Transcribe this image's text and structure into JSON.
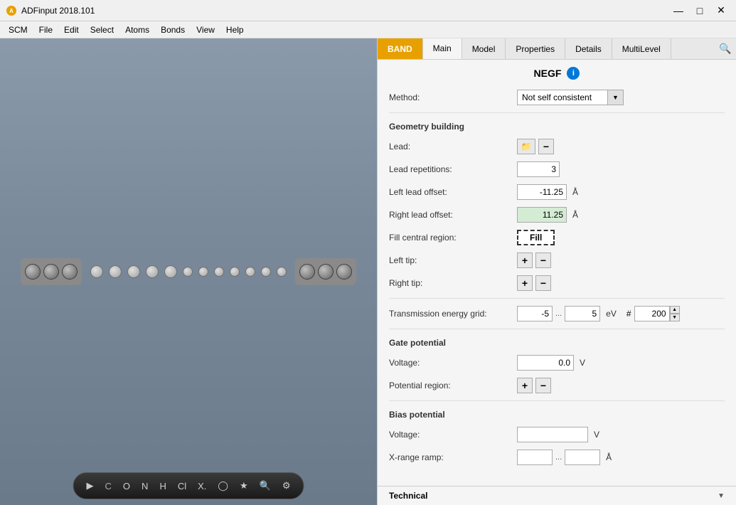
{
  "titleBar": {
    "title": "ADFinput 2018.101",
    "iconColor": "#e8a000",
    "minimize": "—",
    "maximize": "□",
    "close": "✕"
  },
  "menuBar": {
    "items": [
      "SCM",
      "File",
      "Edit",
      "Select",
      "Atoms",
      "Bonds",
      "View",
      "Help"
    ]
  },
  "tabs": {
    "items": [
      "BAND",
      "Main",
      "Model",
      "Properties",
      "Details",
      "MultiLevel"
    ],
    "active": "BAND"
  },
  "searchIcon": "🔍",
  "panel": {
    "title": "NEGF",
    "infoIcon": "i",
    "methodLabel": "Method:",
    "methodValue": "Not self consistent",
    "geometrySection": "Geometry building",
    "leadLabel": "Lead:",
    "leadRepetitionsLabel": "Lead repetitions:",
    "leadRepetitionsValue": "3",
    "leftLeadOffsetLabel": "Left lead offset:",
    "leftLeadOffsetValue": "-11.25",
    "leftLeadOffsetUnit": "Å",
    "rightLeadOffsetLabel": "Right lead offset:",
    "rightLeadOffsetValue": "11.25",
    "rightLeadOffsetUnit": "Å",
    "fillCentralLabel": "Fill central region:",
    "fillBtnLabel": "Fill",
    "leftTipLabel": "Left tip:",
    "rightTipLabel": "Right tip:",
    "transmissionLabel": "Transmission energy grid:",
    "transmissionFrom": "-5",
    "transmissionTo": "5",
    "transmissionUnit": "eV",
    "transmissionHash": "#",
    "transmissionCount": "200",
    "gatePotentialSection": "Gate potential",
    "gateVoltageLabel": "Voltage:",
    "gateVoltageValue": "0.0",
    "gateVoltageUnit": "V",
    "gatePotentialRegionLabel": "Potential region:",
    "biasPotentialSection": "Bias potential",
    "biasVoltageLabel": "Voltage:",
    "biasVoltageUnit": "V",
    "biasXRangeLabel": "X-range ramp:",
    "biasXRangeUnit": "Å",
    "technicalLabel": "Technical"
  },
  "bottomToolbar": {
    "cursorIcon": "▶",
    "atomC": "C",
    "atomO": "O",
    "atomN": "N",
    "atomH": "H",
    "atomCl": "Cl",
    "atomX": "X.",
    "atomRing": "◯",
    "starIcon": "★",
    "searchIcon": "🔍",
    "settingsIcon": "⚙"
  }
}
